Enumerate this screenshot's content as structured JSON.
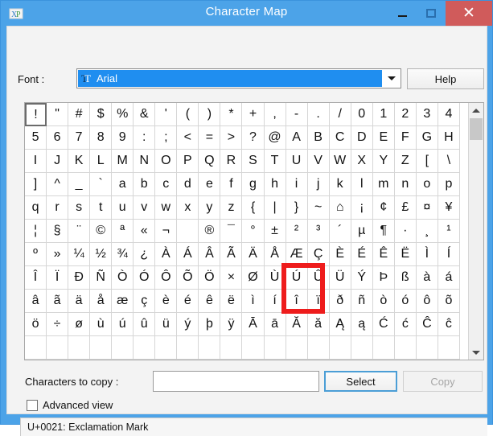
{
  "window": {
    "title": "Character Map",
    "app_icon": "charmap-icon",
    "controls": {
      "minimize": "minimize-icon",
      "maximize": "maximize-icon",
      "close": "✕"
    },
    "colors": {
      "titlebar": "#4ca3e8",
      "close_button": "#d05b5b",
      "selection": "#1f8ef0",
      "annotation": "#ee1c1c",
      "focus_border": "#4b9ed6"
    }
  },
  "font_row": {
    "label": "Font :",
    "selected_font": "Arial",
    "font_icon": "truetype-icon",
    "dropdown_icon": "chevron-down-icon",
    "help_label": "Help"
  },
  "grid": {
    "columns": 20,
    "rows": 11,
    "selected_index": 0,
    "highlighted_char": "|",
    "characters": [
      "!",
      "\"",
      "#",
      "$",
      "%",
      "&",
      "'",
      "(",
      ")",
      "*",
      "+",
      ",",
      "-",
      ".",
      "/",
      "0",
      "1",
      "2",
      "3",
      "4",
      "5",
      "6",
      "7",
      "8",
      "9",
      ":",
      ";",
      "<",
      "=",
      ">",
      "?",
      "@",
      "A",
      "B",
      "C",
      "D",
      "E",
      "F",
      "G",
      "H",
      "I",
      "J",
      "K",
      "L",
      "M",
      "N",
      "O",
      "P",
      "Q",
      "R",
      "S",
      "T",
      "U",
      "V",
      "W",
      "X",
      "Y",
      "Z",
      "[",
      "\\",
      "]",
      "^",
      "_",
      "`",
      "a",
      "b",
      "c",
      "d",
      "e",
      "f",
      "g",
      "h",
      "i",
      "j",
      "k",
      "l",
      "m",
      "n",
      "o",
      "p",
      "q",
      "r",
      "s",
      "t",
      "u",
      "v",
      "w",
      "x",
      "y",
      "z",
      "{",
      "|",
      "}",
      "~",
      "⌂",
      "¡",
      "¢",
      "£",
      "¤",
      "¥",
      "¦",
      "§",
      "¨",
      "©",
      "ª",
      "«",
      "¬",
      "­",
      "®",
      "¯",
      "°",
      "±",
      "²",
      "³",
      "´",
      "µ",
      "¶",
      "·",
      "¸",
      "¹",
      "º",
      "»",
      "¼",
      "½",
      "¾",
      "¿",
      "À",
      "Á",
      "Â",
      "Ã",
      "Ä",
      "Å",
      "Æ",
      "Ç",
      "È",
      "É",
      "Ê",
      "Ë",
      "Ì",
      "Í",
      "Î",
      "Ï",
      "Ð",
      "Ñ",
      "Ò",
      "Ó",
      "Ô",
      "Õ",
      "Ö",
      "×",
      "Ø",
      "Ù",
      "Ú",
      "Û",
      "Ü",
      "Ý",
      "Þ",
      "ß",
      "à",
      "á",
      "â",
      "ã",
      "ä",
      "å",
      "æ",
      "ç",
      "è",
      "é",
      "ê",
      "ë",
      "ì",
      "í",
      "î",
      "ï",
      "ð",
      "ñ",
      "ò",
      "ó",
      "ô",
      "õ",
      "ö",
      "÷",
      "ø",
      "ù",
      "ú",
      "û",
      "ü",
      "ý",
      "þ",
      "ÿ",
      "Ā",
      "ā",
      "Ă",
      "ă",
      "Ą",
      "ą",
      "Ć",
      "ć",
      "Ĉ",
      "ĉ"
    ]
  },
  "scrollbar": {
    "up_icon": "chevron-up-icon",
    "down_icon": "chevron-down-icon"
  },
  "bottom": {
    "copy_label": "Characters to copy :",
    "copy_value": "",
    "copy_placeholder": "",
    "select_label": "Select",
    "copy_button_label": "Copy",
    "advanced_label": "Advanced view",
    "advanced_checked": false
  },
  "status": {
    "text": "U+0021: Exclamation Mark"
  }
}
